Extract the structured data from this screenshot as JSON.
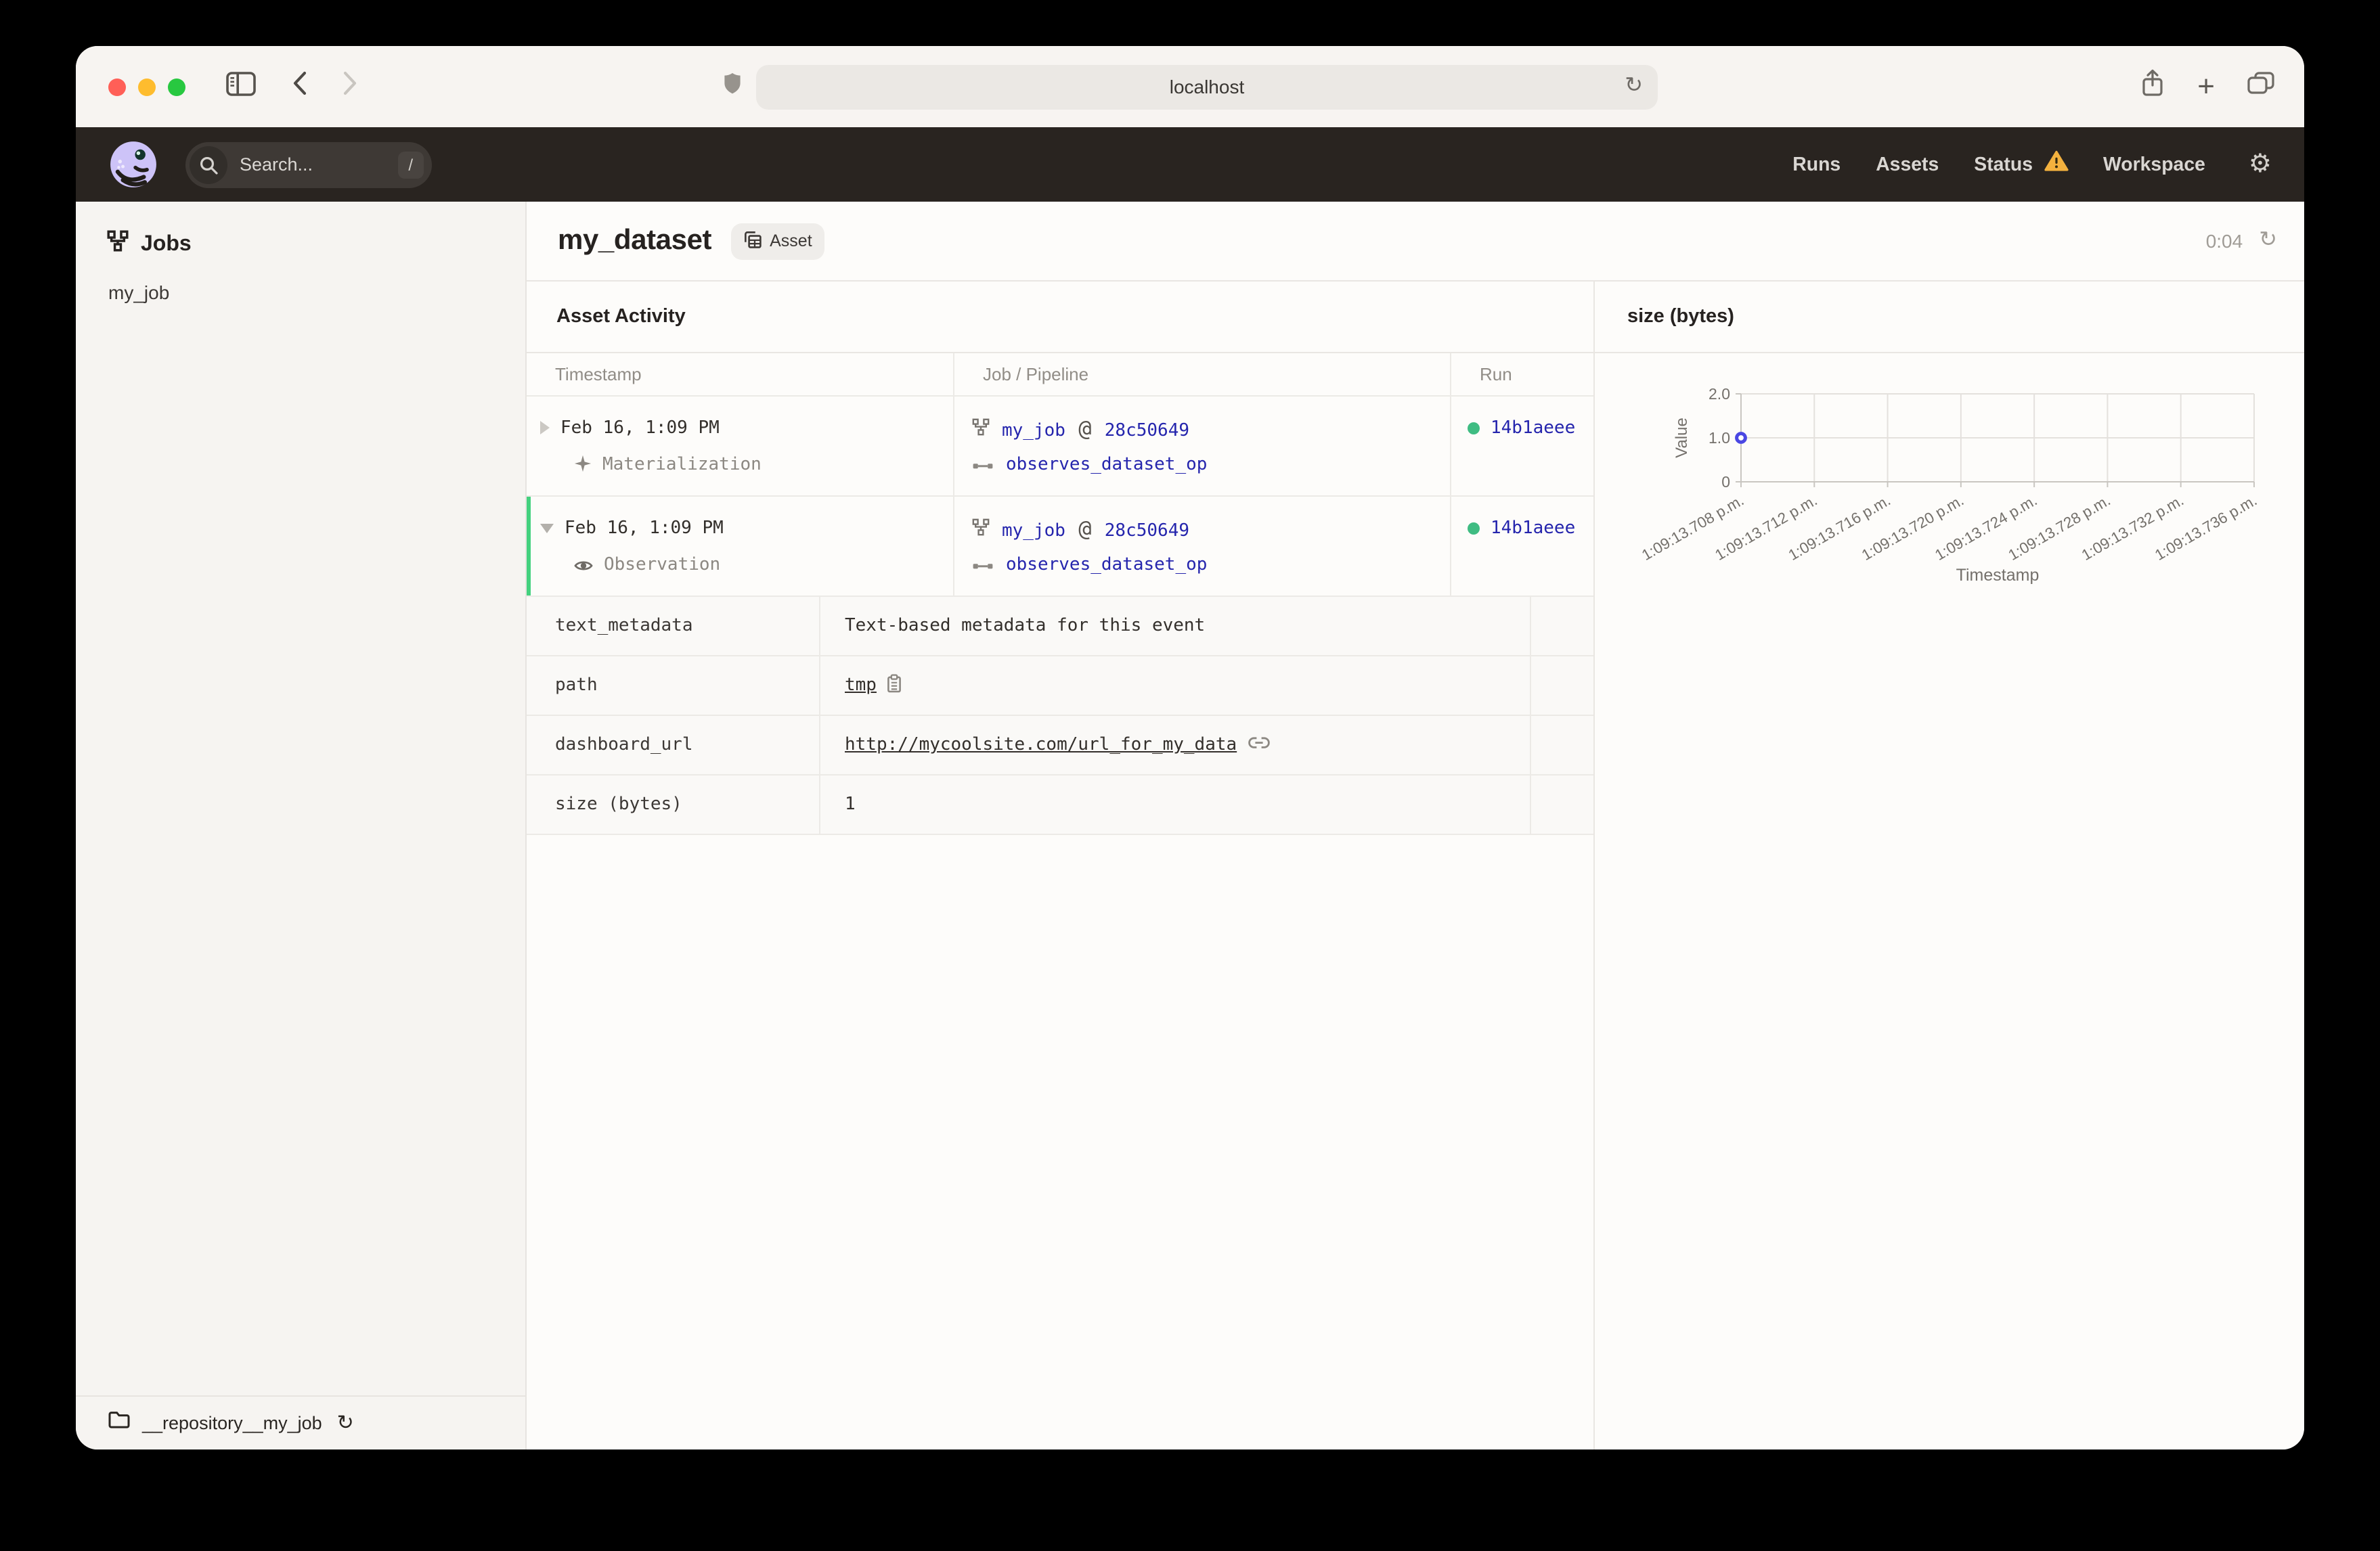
{
  "browser": {
    "url": "localhost",
    "icons": [
      "sidebar-toggle",
      "back-chevron",
      "forward-chevron",
      "shield",
      "reload",
      "share",
      "new-tab-plus",
      "tab-overview"
    ],
    "reload_glyph": "↻",
    "plus_glyph": "+"
  },
  "header": {
    "search_placeholder": "Search...",
    "search_shortcut": "/",
    "nav": [
      {
        "label": "Runs"
      },
      {
        "label": "Assets"
      },
      {
        "label": "Status",
        "has_warning": true
      },
      {
        "label": "Workspace"
      }
    ],
    "gear_glyph": "⚙"
  },
  "sidebar": {
    "section_title": "Jobs",
    "items": [
      {
        "label": "my_job"
      }
    ],
    "repository": {
      "label": "__repository__my_job",
      "refresh_glyph": "↻"
    }
  },
  "page": {
    "title": "my_dataset",
    "type_badge": "Asset",
    "timer": "0:04",
    "refresh_glyph": "↻"
  },
  "activity": {
    "title": "Asset Activity",
    "columns": [
      "Timestamp",
      "Job / Pipeline",
      "Run"
    ],
    "events": [
      {
        "timestamp": "Feb 16, 1:09 PM",
        "event_type": "Materialization",
        "job": "my_job",
        "at": "@",
        "job_hash": "28c50649",
        "op": "observes_dataset_op",
        "run_id": "14b1aeee",
        "expanded": false
      },
      {
        "timestamp": "Feb 16, 1:09 PM",
        "event_type": "Observation",
        "job": "my_job",
        "at": "@",
        "job_hash": "28c50649",
        "op": "observes_dataset_op",
        "run_id": "14b1aeee",
        "expanded": true
      }
    ],
    "metadata": [
      {
        "key": "text_metadata",
        "value": "Text-based metadata for this event",
        "kind": "text"
      },
      {
        "key": "path",
        "value": "tmp",
        "kind": "copyable"
      },
      {
        "key": "dashboard_url",
        "value": "http://mycoolsite.com/url_for_my_data",
        "kind": "link"
      },
      {
        "key": "size (bytes)",
        "value": "1",
        "kind": "text"
      }
    ]
  },
  "chart_data": {
    "type": "scatter",
    "title": "size (bytes)",
    "xlabel": "Timestamp",
    "ylabel": "Value",
    "x_tick_labels": [
      "1:09:13.708 p.m.",
      "1:09:13.712 p.m.",
      "1:09:13.716 p.m.",
      "1:09:13.720 p.m.",
      "1:09:13.724 p.m.",
      "1:09:13.728 p.m.",
      "1:09:13.732 p.m.",
      "1:09:13.736 p.m."
    ],
    "y_tick_labels": [
      "0",
      "1.0",
      "2.0"
    ],
    "y_tick_values": [
      0,
      1,
      2
    ],
    "ylim": [
      0,
      2
    ],
    "grid": true,
    "legend": "none",
    "point_color": "#4a47e3",
    "points": [
      {
        "x": "1:09:13.708 p.m.",
        "y": 1
      }
    ]
  },
  "colors": {
    "accent_link": "#2525ad",
    "run_success_green": "#3fbc82",
    "expanded_row_green": "#43d17e",
    "warning_amber": "#f3b13e",
    "header_dark": "#292420"
  }
}
